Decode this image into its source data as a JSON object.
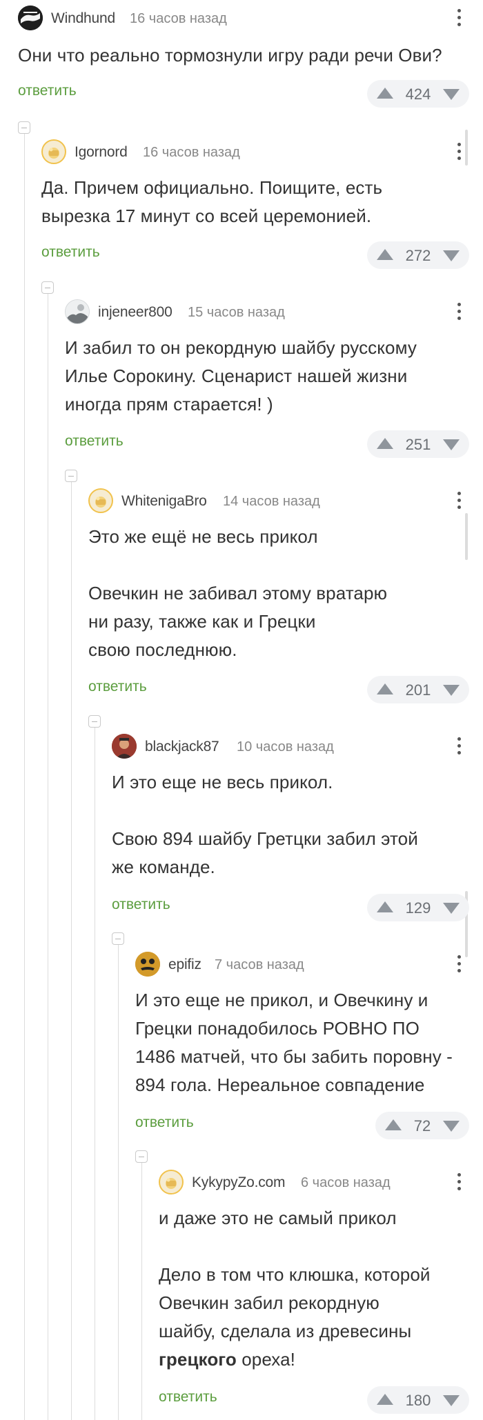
{
  "comments": [
    {
      "author": "Windhund",
      "time": "16 часов назад",
      "text": [
        "Они что реально тормознули игру ради речи Ови?"
      ],
      "reply": "ответить",
      "votes": "424"
    },
    {
      "author": "Igornord",
      "time": "16 часов назад",
      "text": [
        "Да. Причем официально. Поищите, есть",
        "вырезка 17 минут со всей церемонией."
      ],
      "reply": "ответить",
      "votes": "272"
    },
    {
      "author": "injeneer800",
      "time": "15 часов назад",
      "text": [
        "И забил то он рекордную шайбу русскому",
        "Илье Сорокину. Сценарист нашей жизни",
        "иногда прям старается! )"
      ],
      "reply": "ответить",
      "votes": "251"
    },
    {
      "author": "WhitenigaBro",
      "time": "14 часов назад",
      "text": [
        "Это же ещё не весь прикол",
        "",
        "Овечкин не забивал этому вратарю",
        "ни разу, также как и Грецки",
        "свою последнюю."
      ],
      "reply": "ответить",
      "votes": "201"
    },
    {
      "author": "blackjack87",
      "time": "10 часов назад",
      "text": [
        "И это еще не весь прикол.",
        "",
        "Свою 894 шайбу Гретцки забил этой",
        "же команде."
      ],
      "reply": "ответить",
      "votes": "129"
    },
    {
      "author": "epifiz",
      "time": "7 часов назад",
      "text": [
        "И это еще не прикол, и Овечкину и",
        "Грецки понадобилось РОВНО ПО",
        "1486 матчей, что бы забить поровну -",
        "894 гола. Нереальное совпадение"
      ],
      "reply": "ответить",
      "votes": "72"
    },
    {
      "author": "KykypyZo.com",
      "time": "6 часов назад",
      "text": [
        "и даже это не самый прикол",
        "",
        "Дело в том что клюшка, которой",
        "Овечкин забил рекордную",
        "шайбу, сделала из древесины"
      ],
      "text_bold": "грецкого",
      "text_tail": " ореха!",
      "reply": "ответить",
      "votes": "180"
    }
  ],
  "icons": {
    "more": "more-vertical-icon",
    "upvote": "arrow-up-icon",
    "downvote": "arrow-down-icon",
    "collapse": "collapse-minus-icon"
  },
  "colors": {
    "reply": "#5b9d3e",
    "vote_bg": "#f2f3f5",
    "vote_arrow": "#8f959c",
    "thread_line": "#dcdcdc"
  }
}
